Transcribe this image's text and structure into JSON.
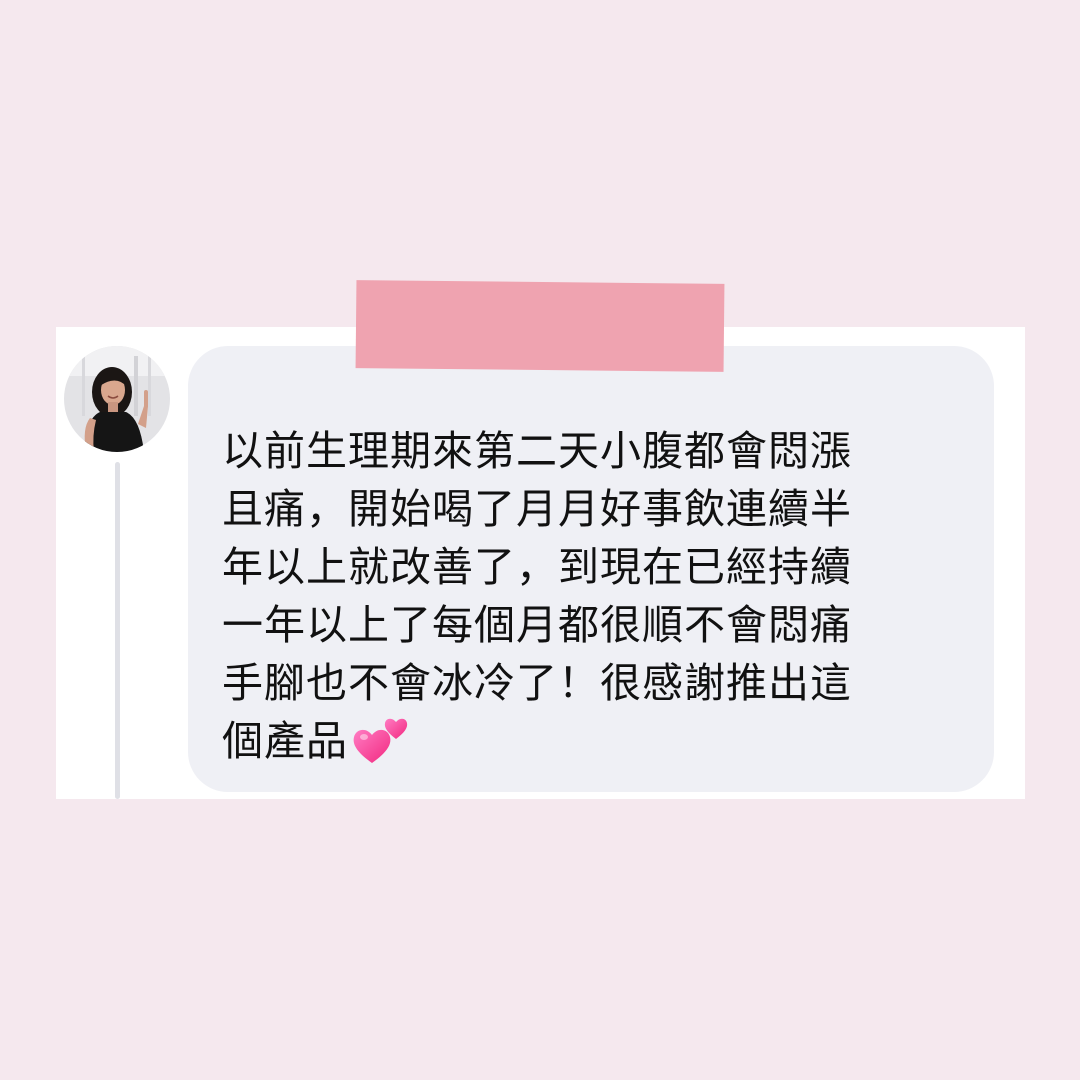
{
  "colors": {
    "page_background": "#f5e8ee",
    "card_background": "#ffffff",
    "tape": "#efa3b0",
    "bubble_background": "#eff0f5",
    "thread_line": "#dfe0e6",
    "text": "#111111",
    "heart_pink": "#ff3d98"
  },
  "comment": {
    "avatar_icon": "user-avatar-photo",
    "emoji_icon": "two-hearts-emoji",
    "message_lines": [
      "以前生理期來第二天小腹都會悶漲",
      "且痛，開始喝了月月好事飲連續半",
      "年以上就改善了，到現在已經持續",
      "一年以上了每個月都很順不會悶痛",
      "手腳也不會冰冷了！很感謝推出這",
      "個產品"
    ]
  }
}
